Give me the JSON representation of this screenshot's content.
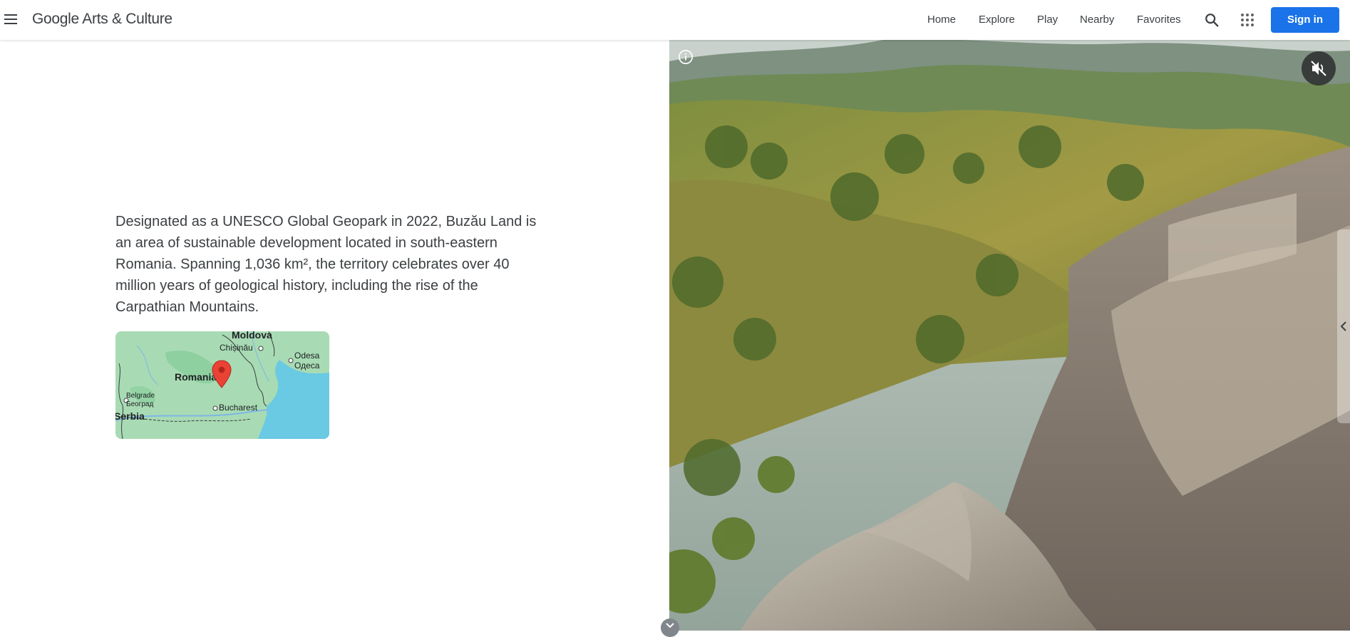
{
  "header": {
    "logo": "Google Arts & Culture",
    "nav": {
      "home": "Home",
      "explore": "Explore",
      "play": "Play",
      "nearby": "Nearby",
      "favorites": "Favorites"
    },
    "signin_label": "Sign in"
  },
  "main": {
    "description": "Designated as a UNESCO Global Geopark in 2022, Buzău Land is an area of sustainable development located in south-eastern Romania. Spanning 1,036 km², the territory celebrates over 40 million years of geological history, including the rise of the Carpathian Mountains."
  },
  "map": {
    "labels": {
      "moldova": "Moldova",
      "chisinau": "Chișinău",
      "odesa": "Odesa",
      "odesa_cyrillic": "Одеса",
      "romania": "Romania",
      "belgrade": "Belgrade",
      "belgrade_cyrillic": "Београд",
      "bucharest": "Bucharest",
      "serbia": "Serbia"
    }
  },
  "colors": {
    "brand_blue": "#1a73e8",
    "text": "#3c4043",
    "map_land": "#a8dbb4",
    "map_sea": "#6ac9e3",
    "marker": "#ea4335"
  },
  "icons": {
    "menu": "menu-icon",
    "search": "search-icon",
    "apps": "apps-grid-icon",
    "info": "info-icon",
    "mute": "volume-off-icon",
    "side_tab": "chevron-left-icon",
    "scroll": "chevron-down-icon",
    "marker": "map-marker-icon"
  }
}
